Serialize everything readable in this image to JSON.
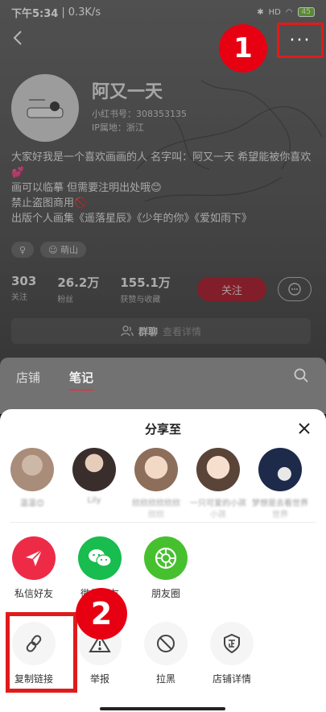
{
  "status_bar": {
    "time": "下午5:34",
    "speed": "0.3K/s",
    "battery": "45",
    "network": "HD"
  },
  "profile": {
    "nickname": "阿又一天",
    "redbook_id": "小红书号：308353135",
    "ip_location": "IP属地：浙江",
    "bio_lines": [
      "大家好我是一个喜欢画画的人 名字叫：阿又一天 希望能被你喜欢💕",
      "画可以临摹 但需要注明出处哦😊",
      "禁止盗图商用🚫",
      "出版个人画集《遥落星辰》《少年的你》《爱如雨下》"
    ],
    "tags": [
      "♀",
      "☺ 萌山"
    ],
    "stats": [
      {
        "num": "303",
        "label": "关注"
      },
      {
        "num": "26.2万",
        "label": "粉丝"
      },
      {
        "num": "155.1万",
        "label": "获赞与收藏"
      }
    ],
    "follow_label": "关注",
    "group_label": "群聊",
    "group_detail": "查看详情",
    "tabs": [
      "店铺",
      "笔记"
    ],
    "more_label": "···",
    "callout_1": "1"
  },
  "share_sheet": {
    "title": "分享至",
    "friends": [
      {
        "name": "温温😊",
        "color": "#a98d7a"
      },
      {
        "name": "Lily",
        "color": "#6b5b57"
      },
      {
        "name": "欣欣欣欣欣欣",
        "sub": "欣欣",
        "color": "#c9a88e"
      },
      {
        "name": "一只可爱的小孩",
        "sub": "小孩",
        "color": "#e3c7b0"
      },
      {
        "name": "梦想是去看世界",
        "sub": "世界",
        "color": "#1d2a4a"
      }
    ],
    "row1": [
      {
        "label": "私信好友",
        "icon": "send-icon"
      },
      {
        "label": "微信好友",
        "icon": "wechat-icon"
      },
      {
        "label": "朋友圈",
        "icon": "moments-icon"
      }
    ],
    "row2": [
      {
        "label": "复制链接",
        "icon": "link-icon"
      },
      {
        "label": "举报",
        "icon": "warning-icon"
      },
      {
        "label": "拉黑",
        "icon": "block-icon"
      },
      {
        "label": "店铺详情",
        "icon": "shop-certificate-icon"
      }
    ],
    "callout_2": "2"
  },
  "colors": {
    "brand_red": "#ee2b47",
    "wechat_green": "#18bc4f",
    "moments_green": "#47c02f",
    "annotation_red": "#e01b1b"
  }
}
